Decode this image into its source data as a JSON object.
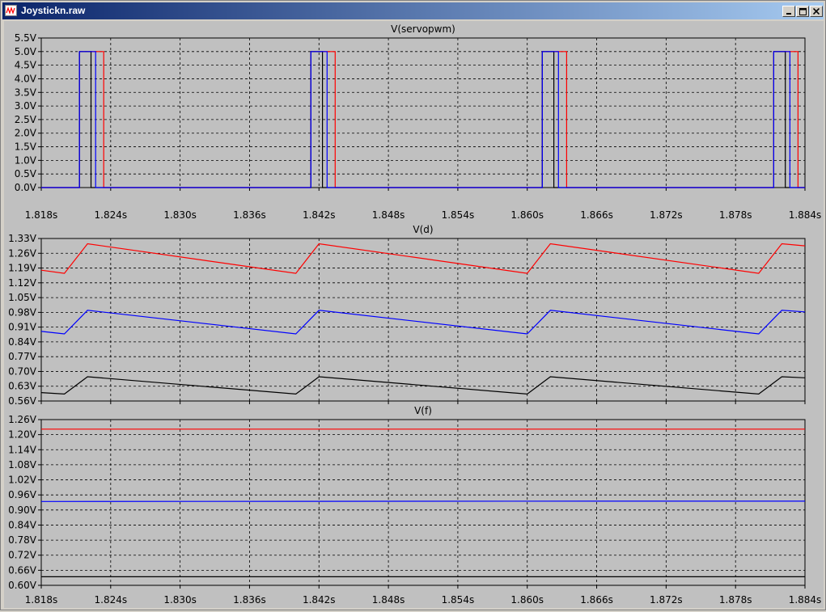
{
  "window": {
    "title": "Joystickn.raw",
    "icons": {
      "app": "waveform-icon",
      "minimize": "minimize-icon",
      "maximize": "maximize-icon",
      "close": "close-icon"
    }
  },
  "colors": {
    "background": "#c0c0c0",
    "grid": "#000000",
    "series_red": "#ff0000",
    "series_blue": "#0000ff",
    "series_black": "#000000",
    "text": "#000000"
  },
  "chart_data": [
    {
      "type": "line",
      "title": "V(servopwm)",
      "x_ticks": [
        "1.818s",
        "1.824s",
        "1.830s",
        "1.836s",
        "1.842s",
        "1.848s",
        "1.854s",
        "1.860s",
        "1.866s",
        "1.872s",
        "1.878s",
        "1.884s"
      ],
      "xlim": [
        1.818,
        1.884
      ],
      "y_ticks": [
        "0.0V",
        "0.5V",
        "1.0V",
        "1.5V",
        "2.0V",
        "2.5V",
        "3.0V",
        "3.5V",
        "4.0V",
        "4.5V",
        "5.0V",
        "5.5V"
      ],
      "ylim": [
        0,
        5.5
      ],
      "grid": true,
      "period": 0.02,
      "high": 5.0,
      "low": 0.0,
      "series": [
        {
          "color": "#ff0000",
          "rises": [
            1.8213,
            1.8413,
            1.8613,
            1.8813
          ],
          "widths": [
            0.0021,
            0.0021,
            0.0021,
            0.0021
          ]
        },
        {
          "color": "#000000",
          "rises": [
            1.8213,
            1.8413,
            1.8613,
            1.8813
          ],
          "widths": [
            0.001,
            0.001,
            0.001,
            0.001
          ]
        },
        {
          "color": "#0000ff",
          "rises": [
            1.8213,
            1.8413,
            1.8613,
            1.8813
          ],
          "widths": [
            0.0014,
            0.0014,
            0.0014,
            0.0014
          ]
        }
      ]
    },
    {
      "type": "line",
      "title": "V(d)",
      "x_ticks": [
        "1.818s",
        "1.824s",
        "1.830s",
        "1.836s",
        "1.842s",
        "1.848s",
        "1.854s",
        "1.860s",
        "1.866s",
        "1.872s",
        "1.878s",
        "1.884s"
      ],
      "xlim": [
        1.818,
        1.884
      ],
      "y_ticks": [
        "0.56V",
        "0.63V",
        "0.70V",
        "0.77V",
        "0.84V",
        "0.91V",
        "0.98V",
        "1.05V",
        "1.12V",
        "1.19V",
        "1.26V",
        "1.33V"
      ],
      "ylim": [
        0.56,
        1.33
      ],
      "grid": true,
      "series": [
        {
          "color": "#ff0000",
          "x": [
            1.818,
            1.82,
            1.822,
            1.84,
            1.842,
            1.86,
            1.862,
            1.88,
            1.882,
            1.884
          ],
          "y": [
            1.18,
            1.165,
            1.305,
            1.165,
            1.305,
            1.165,
            1.305,
            1.165,
            1.305,
            1.295
          ]
        },
        {
          "color": "#0000ff",
          "x": [
            1.818,
            1.82,
            1.822,
            1.84,
            1.842,
            1.86,
            1.862,
            1.88,
            1.882,
            1.884
          ],
          "y": [
            0.89,
            0.878,
            0.99,
            0.878,
            0.99,
            0.878,
            0.99,
            0.878,
            0.99,
            0.982
          ]
        },
        {
          "color": "#000000",
          "x": [
            1.818,
            1.82,
            1.822,
            1.84,
            1.842,
            1.86,
            1.862,
            1.88,
            1.882,
            1.884
          ],
          "y": [
            0.6,
            0.593,
            0.675,
            0.593,
            0.675,
            0.593,
            0.675,
            0.593,
            0.675,
            0.67
          ]
        }
      ]
    },
    {
      "type": "line",
      "title": "V(f)",
      "x_ticks": [
        "1.818s",
        "1.824s",
        "1.830s",
        "1.836s",
        "1.842s",
        "1.848s",
        "1.854s",
        "1.860s",
        "1.866s",
        "1.872s",
        "1.878s",
        "1.884s"
      ],
      "xlim": [
        1.818,
        1.884
      ],
      "y_ticks": [
        "0.60V",
        "0.66V",
        "0.72V",
        "0.78V",
        "0.84V",
        "0.90V",
        "0.96V",
        "1.02V",
        "1.08V",
        "1.14V",
        "1.20V",
        "1.26V"
      ],
      "ylim": [
        0.6,
        1.26
      ],
      "grid": true,
      "series": [
        {
          "color": "#ff0000",
          "x": [
            1.818,
            1.884
          ],
          "y": [
            1.222,
            1.222
          ]
        },
        {
          "color": "#0000ff",
          "x": [
            1.818,
            1.866,
            1.884
          ],
          "y": [
            0.934,
            0.935,
            0.935
          ]
        },
        {
          "color": "#000000",
          "x": [
            1.818,
            1.884
          ],
          "y": [
            0.634,
            0.634
          ]
        }
      ]
    }
  ]
}
